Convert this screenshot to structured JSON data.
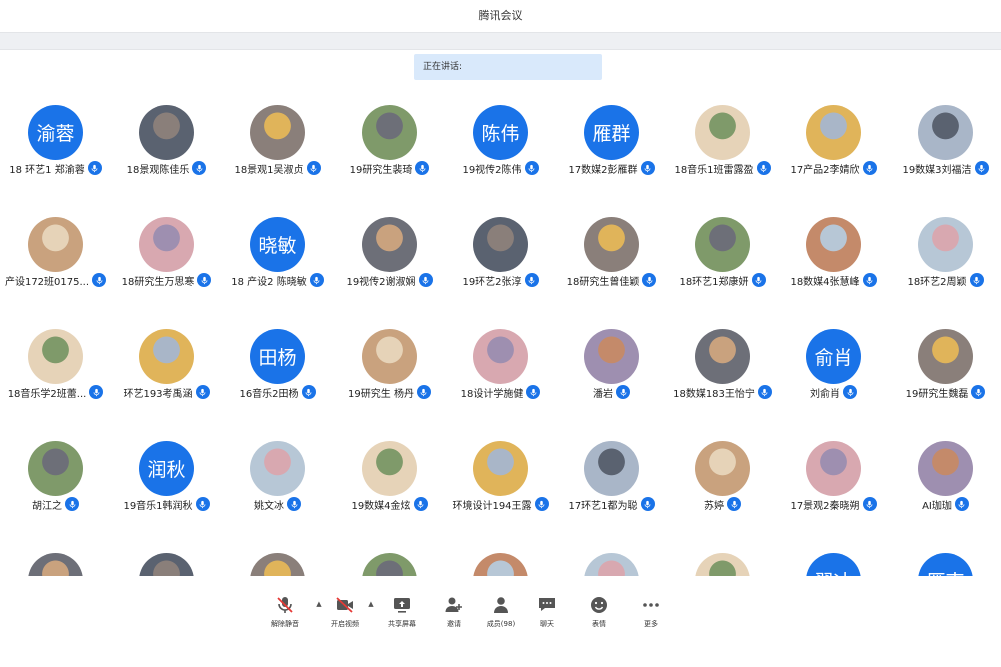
{
  "app": {
    "title": "腾讯会议"
  },
  "speaking": {
    "label": "正在讲话:"
  },
  "participants": [
    {
      "name": "18 环艺1 郑渝蓉",
      "avatar_text": "渝蓉"
    },
    {
      "name": "18景观陈佳乐",
      "avatar_text": ""
    },
    {
      "name": "18景观1吴淑贞",
      "avatar_text": ""
    },
    {
      "name": "19研究生裴琦",
      "avatar_text": ""
    },
    {
      "name": "19视传2陈伟",
      "avatar_text": "陈伟"
    },
    {
      "name": "17数媒2彭雁群",
      "avatar_text": "雁群"
    },
    {
      "name": "18音乐1班雷露盈",
      "avatar_text": ""
    },
    {
      "name": "17产品2李婧欣",
      "avatar_text": ""
    },
    {
      "name": "19数媒3刘福洁",
      "avatar_text": ""
    },
    {
      "name": "产设172班0175...",
      "avatar_text": ""
    },
    {
      "name": "18研究生万思寒",
      "avatar_text": ""
    },
    {
      "name": "18 产设2 陈晓敏",
      "avatar_text": "晓敏"
    },
    {
      "name": "19视传2谢淑娴",
      "avatar_text": ""
    },
    {
      "name": "19环艺2张淳",
      "avatar_text": ""
    },
    {
      "name": "18研究生曾佳颖",
      "avatar_text": ""
    },
    {
      "name": "18环艺1郑康妍",
      "avatar_text": ""
    },
    {
      "name": "18数媒4张慧峰",
      "avatar_text": ""
    },
    {
      "name": "18环艺2周颖",
      "avatar_text": ""
    },
    {
      "name": "18音乐学2班蕾...",
      "avatar_text": ""
    },
    {
      "name": "环艺193考禹涵",
      "avatar_text": ""
    },
    {
      "name": "16音乐2田杨",
      "avatar_text": "田杨"
    },
    {
      "name": "19研究生 杨丹",
      "avatar_text": ""
    },
    {
      "name": "18设计学施健",
      "avatar_text": ""
    },
    {
      "name": "潘岩",
      "avatar_text": ""
    },
    {
      "name": "18数媒183王怡宁",
      "avatar_text": ""
    },
    {
      "name": "刘俞肖",
      "avatar_text": "俞肖"
    },
    {
      "name": "19研究生魏磊",
      "avatar_text": ""
    },
    {
      "name": "胡江之",
      "avatar_text": ""
    },
    {
      "name": "19音乐1韩润秋",
      "avatar_text": "润秋"
    },
    {
      "name": "姚文冰",
      "avatar_text": ""
    },
    {
      "name": "19数媒4金炫",
      "avatar_text": ""
    },
    {
      "name": "环境设计194王露",
      "avatar_text": ""
    },
    {
      "name": "17环艺1都为聪",
      "avatar_text": ""
    },
    {
      "name": "苏婷",
      "avatar_text": ""
    },
    {
      "name": "17景观2秦晓朔",
      "avatar_text": ""
    },
    {
      "name": "AI珈珈",
      "avatar_text": ""
    },
    {
      "name": "",
      "avatar_text": ""
    },
    {
      "name": "",
      "avatar_text": ""
    },
    {
      "name": "",
      "avatar_text": ""
    },
    {
      "name": "",
      "avatar_text": ""
    },
    {
      "name": "",
      "avatar_text": ""
    },
    {
      "name": "",
      "avatar_text": ""
    },
    {
      "name": "",
      "avatar_text": ""
    },
    {
      "name": "",
      "avatar_text": "翟冰"
    },
    {
      "name": "",
      "avatar_text": "雁南"
    }
  ],
  "photo_colors": [
    "#c9a27e",
    "#8a7f7a",
    "#e0b45a",
    "#6d6f78",
    "#b7c7d6",
    "#d8a8b0",
    "#7f9a6a",
    "#a9b6c8",
    "#5a6270",
    "#e6d3b8",
    "#9e8fb0",
    "#c48a6a"
  ],
  "toolbar": {
    "items": [
      {
        "label": "解除静音",
        "icon": "mic-muted-icon"
      },
      {
        "label": "开启视频",
        "icon": "video-off-icon"
      },
      {
        "label": "共享屏幕",
        "icon": "share-screen-icon"
      },
      {
        "label": "邀请",
        "icon": "invite-icon"
      },
      {
        "label": "成员(98)",
        "icon": "members-icon"
      },
      {
        "label": "聊天",
        "icon": "chat-icon"
      },
      {
        "label": "表情",
        "icon": "emoji-icon"
      },
      {
        "label": "更多",
        "icon": "more-icon"
      }
    ],
    "caret": "▲"
  },
  "colors": {
    "accent": "#1a73e8",
    "muted_red": "#e53935",
    "speaking_bg": "#d9e9fb"
  }
}
